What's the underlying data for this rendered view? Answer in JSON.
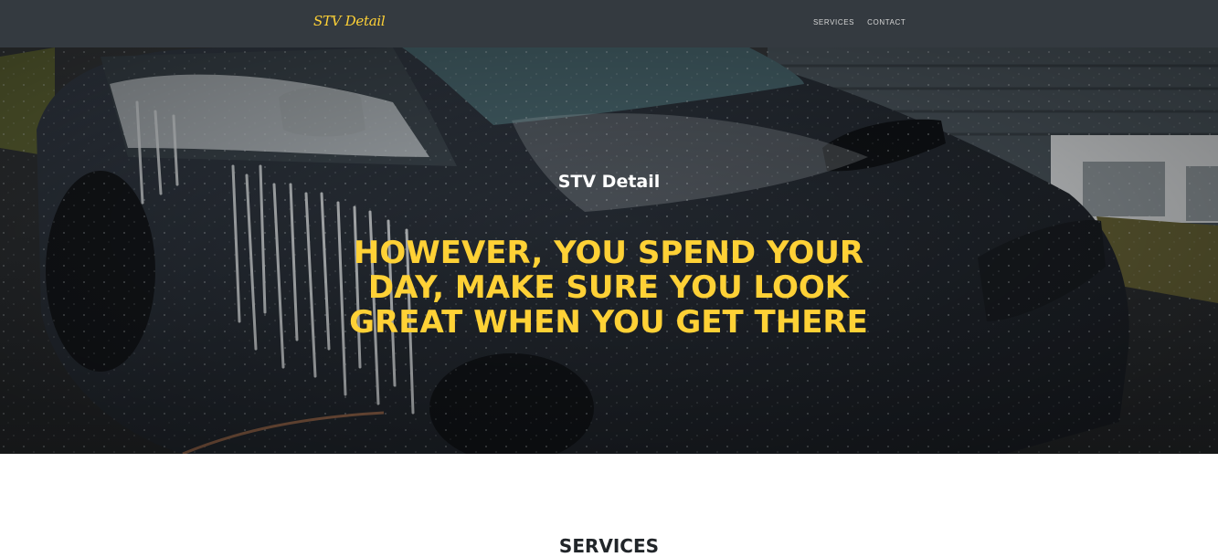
{
  "navbar": {
    "brand": "STV Detail",
    "links": [
      {
        "label": "SERVICES"
      },
      {
        "label": "CONTACT"
      }
    ]
  },
  "hero": {
    "subtitle": "STV Detail",
    "heading": "HOWEVER, YOU SPEND YOUR DAY, MAKE SURE YOU LOOK GREAT WHEN YOU GET THERE",
    "image": "car-wash-foam-photo"
  },
  "services": {
    "title": "SERVICES"
  },
  "colors": {
    "accent": "#fed136",
    "navbar_bg": "#343a40",
    "text_dark": "#212529"
  }
}
